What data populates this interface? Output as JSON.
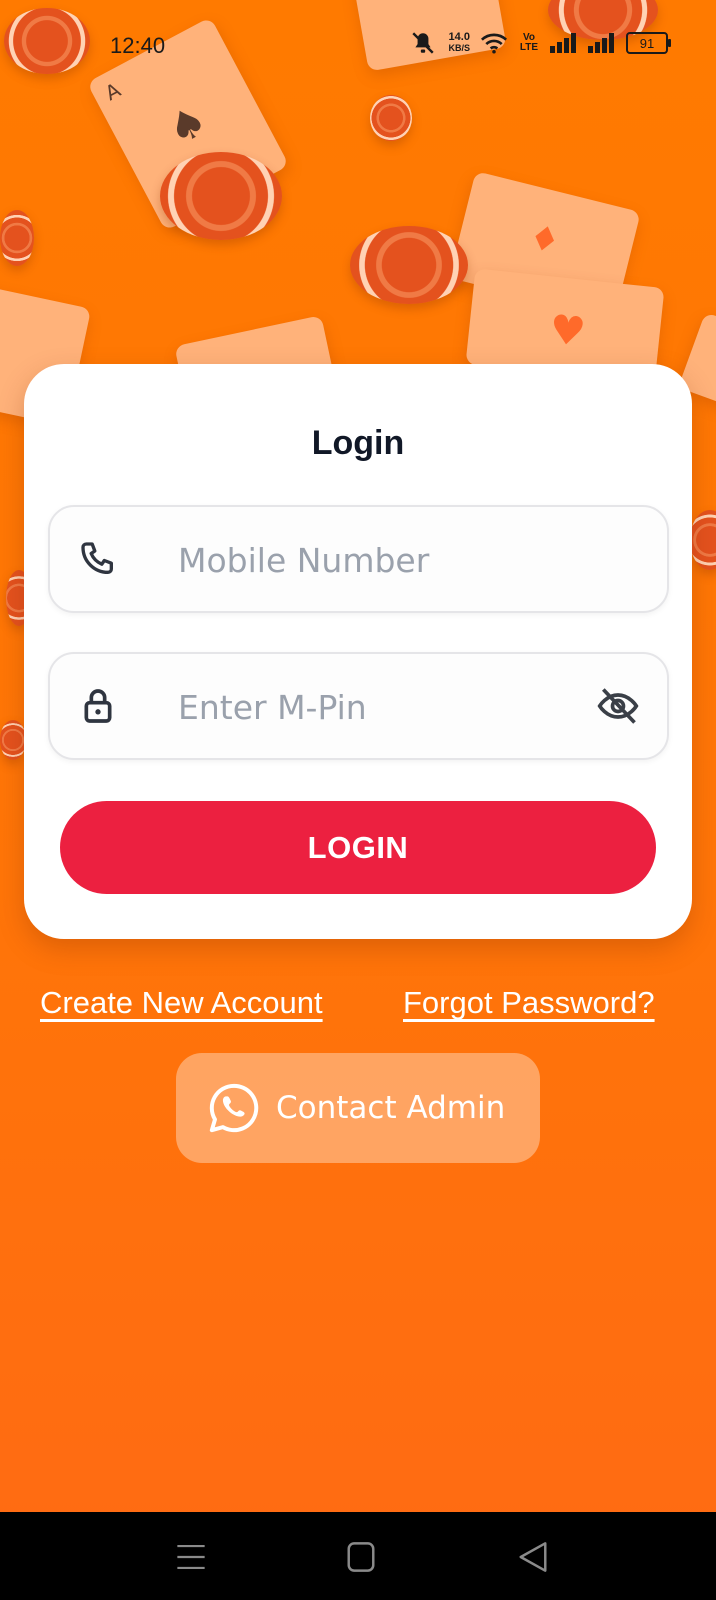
{
  "status_bar": {
    "time": "12:40",
    "net_speed_value": "14.0",
    "net_speed_unit": "KB/S",
    "volte_label": "Vo LTE",
    "battery": "91",
    "icons": [
      "mute-icon",
      "wifi-icon",
      "volte-icon",
      "signal-icon",
      "signal-icon",
      "battery-icon"
    ]
  },
  "login": {
    "title": "Login",
    "mobile_placeholder": "Mobile Number",
    "mobile_value": "",
    "pin_placeholder": "Enter M-Pin",
    "pin_value": "",
    "login_button": "LOGIN"
  },
  "links": {
    "create_account": "Create New Account",
    "forgot_password": "Forgot Password?"
  },
  "contact": {
    "label": "Contact Admin",
    "icon": "whatsapp-icon"
  },
  "colors": {
    "background": "#ff7a00",
    "card": "#ffffff",
    "login_button": "#ec2040",
    "placeholder": "#9aa1ac"
  },
  "background_card_letters": {
    "ace": "A"
  },
  "nav_bar": {
    "icons": [
      "menu-icon",
      "home-icon",
      "back-icon"
    ]
  }
}
